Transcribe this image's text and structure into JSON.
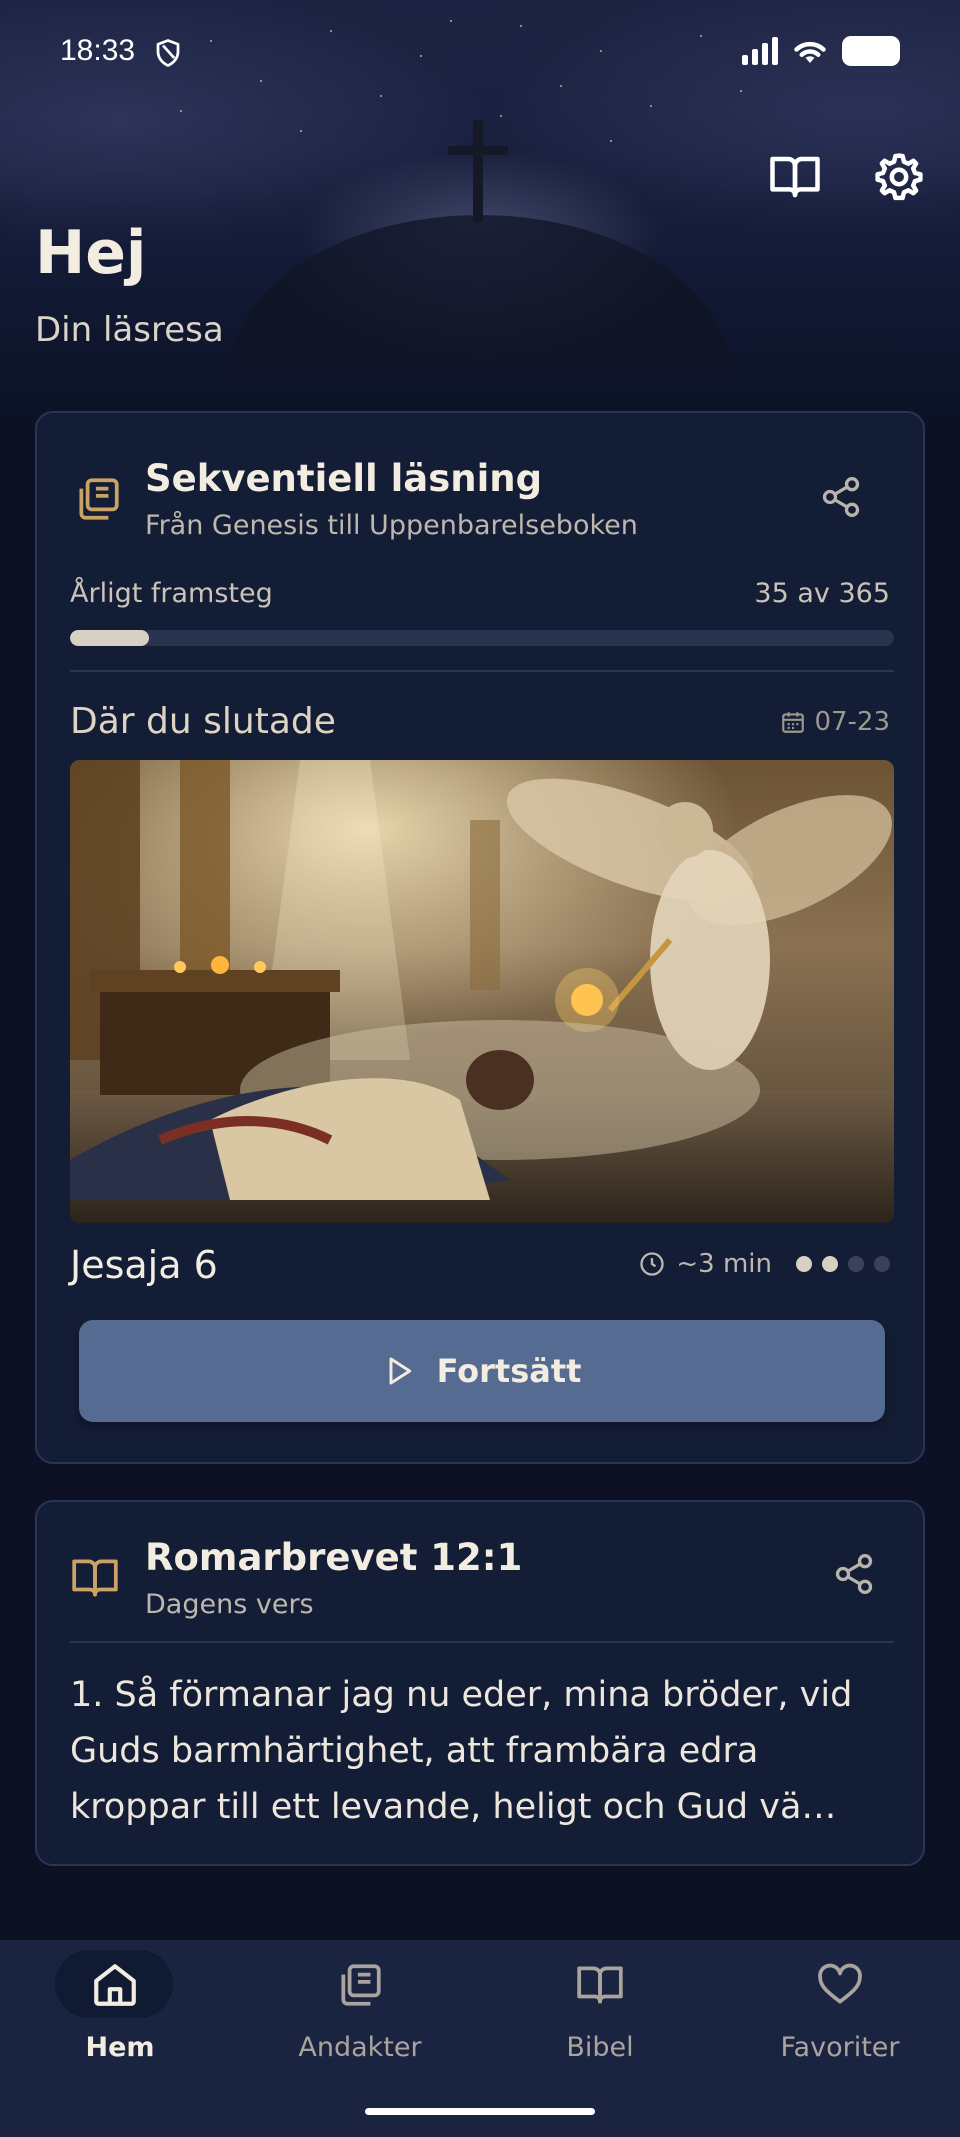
{
  "status_bar": {
    "time": "18:33"
  },
  "header": {
    "greeting": "Hej",
    "subtitle": "Din läsresa"
  },
  "reading_card": {
    "title": "Sekventiell läsning",
    "subtitle": "Från Genesis till Uppenbarelseboken",
    "progress_label": "Årligt framsteg",
    "progress_count": "35 av 365",
    "progress_fraction": 0.096,
    "where_title": "Där du slutade",
    "date": "07-23",
    "chapter": "Jesaja 6",
    "duration": "~3 min",
    "dots_total": 4,
    "dots_active": 2,
    "continue_label": "Fortsätt"
  },
  "verse_card": {
    "title": "Romarbrevet 12:1",
    "subtitle": "Dagens vers",
    "text": "1. Så förmanar jag nu eder, mina bröder, vid Guds barmhärtighet, att frambära edra kroppar till ett levande, heligt och Gud vä…"
  },
  "bottom_nav": {
    "items": [
      {
        "label": "Hem",
        "icon": "home-icon",
        "active": true
      },
      {
        "label": "Andakter",
        "icon": "devotions-icon",
        "active": false
      },
      {
        "label": "Bibel",
        "icon": "book-icon",
        "active": false
      },
      {
        "label": "Favoriter",
        "icon": "heart-icon",
        "active": false
      }
    ]
  },
  "colors": {
    "accent_gold": "#c9a264",
    "button_blue": "#566b92",
    "background": "#0c1224"
  }
}
